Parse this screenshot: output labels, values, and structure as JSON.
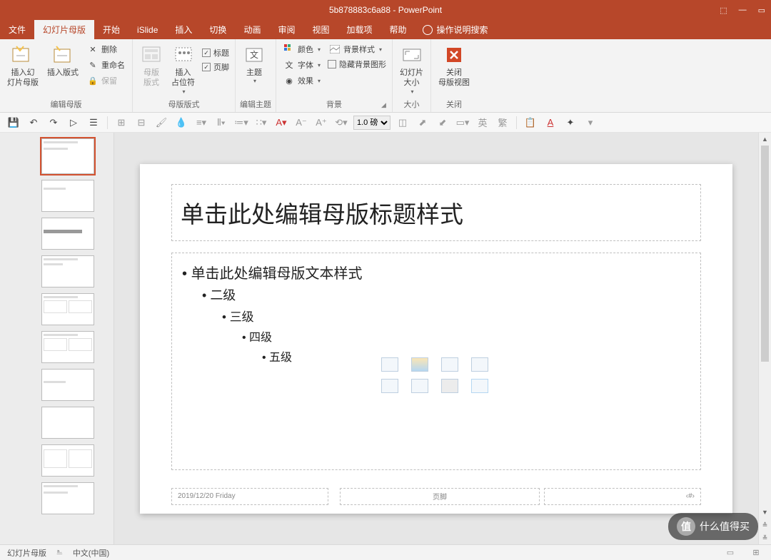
{
  "title": "5b878883c6a88 - PowerPoint",
  "tabs": [
    "文件",
    "幻灯片母版",
    "开始",
    "iSlide",
    "插入",
    "切换",
    "动画",
    "审阅",
    "视图",
    "加载项",
    "帮助"
  ],
  "active_tab": 1,
  "tell_me": "操作说明搜索",
  "ribbon": {
    "g1": {
      "label": "编辑母版",
      "insert_master": "插入幻\n灯片母版",
      "insert_layout": "插入版式",
      "delete": "删除",
      "rename": "重命名",
      "preserve": "保留"
    },
    "g2": {
      "label": "母版版式",
      "master_layout": "母版\n版式",
      "insert_ph": "插入\n占位符",
      "chk_title": "标题",
      "chk_footer": "页脚"
    },
    "g3": {
      "label": "编辑主题",
      "themes": "主题"
    },
    "g4": {
      "label": "背景",
      "colors": "颜色",
      "fonts": "字体",
      "effects": "效果",
      "bg_styles": "背景样式",
      "hide_bg": "隐藏背景图形"
    },
    "g5": {
      "label": "大小",
      "slide_size": "幻灯片\n大小"
    },
    "g6": {
      "label": "关闭",
      "close_master": "关闭\n母版视图"
    }
  },
  "qat": {
    "line_weight": "1.0 磅"
  },
  "slide": {
    "title_ph": "单击此处编辑母版标题样式",
    "body_l1": "单击此处编辑母版文本样式",
    "body_l2": "二级",
    "body_l3": "三级",
    "body_l4": "四级",
    "body_l5": "五级",
    "date": "2019/12/20 Friday",
    "footer": "页脚",
    "num": "‹#›"
  },
  "status": {
    "view": "幻灯片母版",
    "lang": "中文(中国)"
  },
  "watermark": "什么值得买"
}
